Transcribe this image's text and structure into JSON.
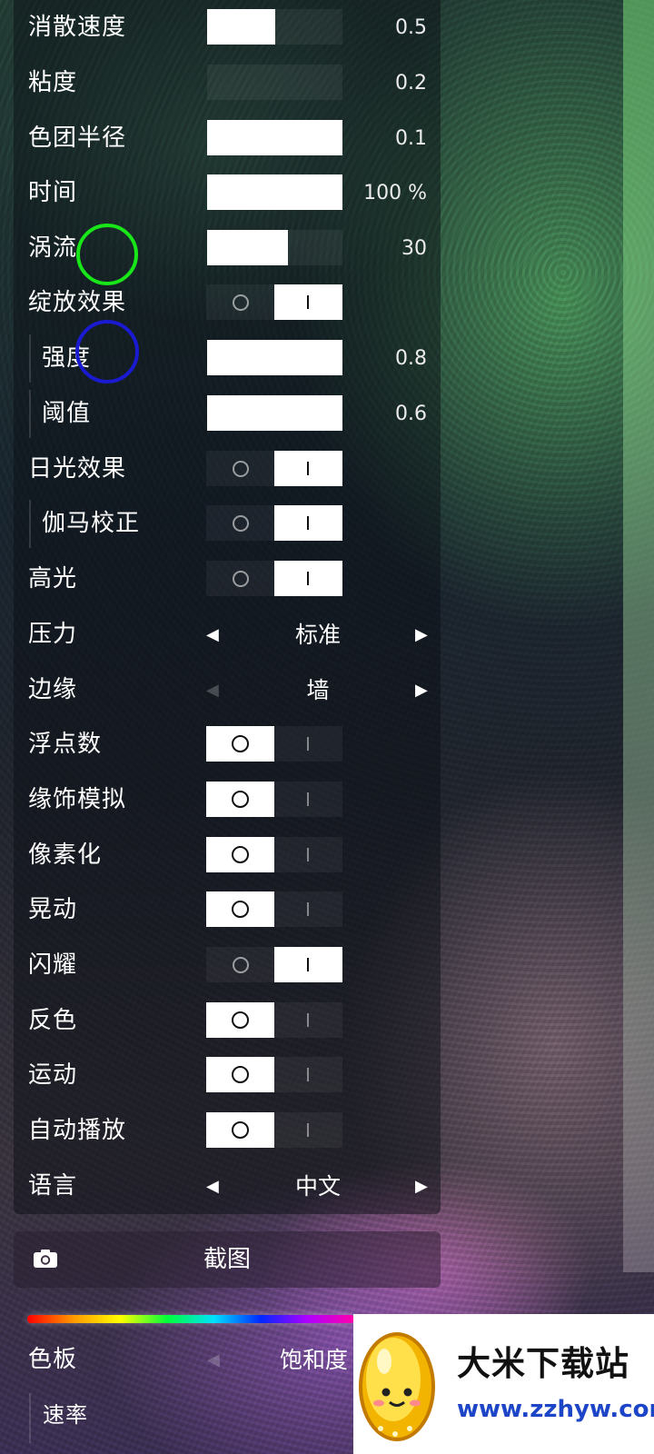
{
  "settings": {
    "dissipation": {
      "label": "消散速度",
      "value": "0.5",
      "level": 0.5
    },
    "viscosity": {
      "label": "粘度",
      "value": "0.2",
      "level": 0.0
    },
    "splat_radius": {
      "label": "色团半径",
      "value": "0.1",
      "level": 1.0
    },
    "time": {
      "label": "时间",
      "value": "100 %",
      "level": 1.0
    },
    "vorticity": {
      "label": "涡流",
      "value": "30",
      "level": 0.6
    },
    "bloom": {
      "label": "绽放效果",
      "state": "on"
    },
    "bloom_intensity": {
      "label": "强度",
      "value": "0.8",
      "level": 1.0
    },
    "bloom_threshold": {
      "label": "阈值",
      "value": "0.6",
      "level": 1.0
    },
    "sunrays": {
      "label": "日光效果",
      "state": "on"
    },
    "gamma": {
      "label": "伽马校正",
      "state": "on"
    },
    "shading": {
      "label": "高光",
      "state": "on"
    },
    "pressure": {
      "label": "压力",
      "value": "标准"
    },
    "edges": {
      "label": "边缘",
      "value": "墙"
    },
    "float": {
      "label": "浮点数",
      "state": "off"
    },
    "dither": {
      "label": "缘饰模拟",
      "state": "off"
    },
    "pixelate": {
      "label": "像素化",
      "state": "off"
    },
    "shake": {
      "label": "晃动",
      "state": "off"
    },
    "shine": {
      "label": "闪耀",
      "state": "on"
    },
    "invert": {
      "label": "反色",
      "state": "off"
    },
    "motion": {
      "label": "运动",
      "state": "off"
    },
    "autoplay": {
      "label": "自动播放",
      "state": "off"
    },
    "language": {
      "label": "语言",
      "value": "中文"
    }
  },
  "screenshot": {
    "label": "截图",
    "icon": "camera-icon"
  },
  "palette": {
    "label": "色板",
    "value": "饱和度"
  },
  "rate": {
    "label": "速率"
  },
  "watermark": {
    "title": "大米下载站",
    "url": "www.zzhyw.com"
  },
  "colors": {
    "accent_fill": "#ffffff",
    "marker_green": "#19e619",
    "marker_blue": "#1a1ad0",
    "watermark_url": "#1d45c8"
  }
}
